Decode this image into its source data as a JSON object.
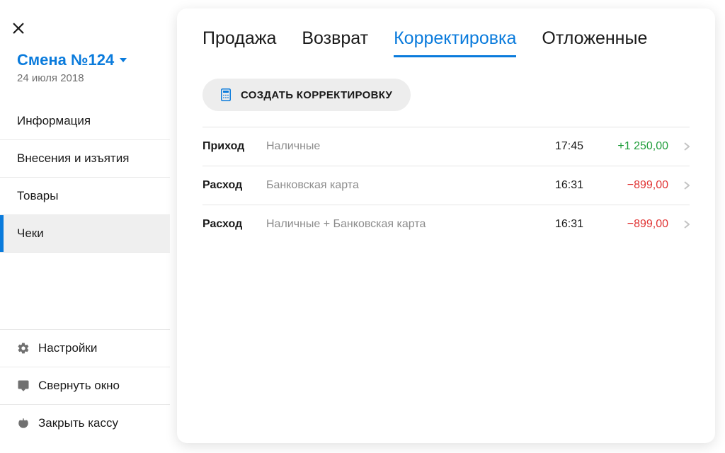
{
  "sidebar": {
    "shift_label": "Смена №124",
    "shift_date": "24 июля 2018",
    "nav": [
      {
        "label": "Информация",
        "active": false
      },
      {
        "label": "Внесения и изъятия",
        "active": false
      },
      {
        "label": "Товары",
        "active": false
      },
      {
        "label": "Чеки",
        "active": true
      }
    ],
    "actions": {
      "settings": "Настройки",
      "minimize": "Свернуть окно",
      "close_register": "Закрыть кассу"
    }
  },
  "main": {
    "tabs": [
      {
        "label": "Продажа",
        "active": false
      },
      {
        "label": "Возврат",
        "active": false
      },
      {
        "label": "Корректировка",
        "active": true
      },
      {
        "label": "Отложенные",
        "active": false
      }
    ],
    "create_button": "СОЗДАТЬ КОРРЕКТИРОВКУ",
    "rows": [
      {
        "type": "Приход",
        "method": "Наличные",
        "time": "17:45",
        "amount": "+1 250,00",
        "sign": "pos"
      },
      {
        "type": "Расход",
        "method": "Банковская карта",
        "time": "16:31",
        "amount": "−899,00",
        "sign": "neg"
      },
      {
        "type": "Расход",
        "method": "Наличные + Банковская карта",
        "time": "16:31",
        "amount": "−899,00",
        "sign": "neg"
      }
    ]
  },
  "colors": {
    "accent": "#0a7bdc",
    "positive": "#1f9d3a",
    "negative": "#e03232"
  }
}
